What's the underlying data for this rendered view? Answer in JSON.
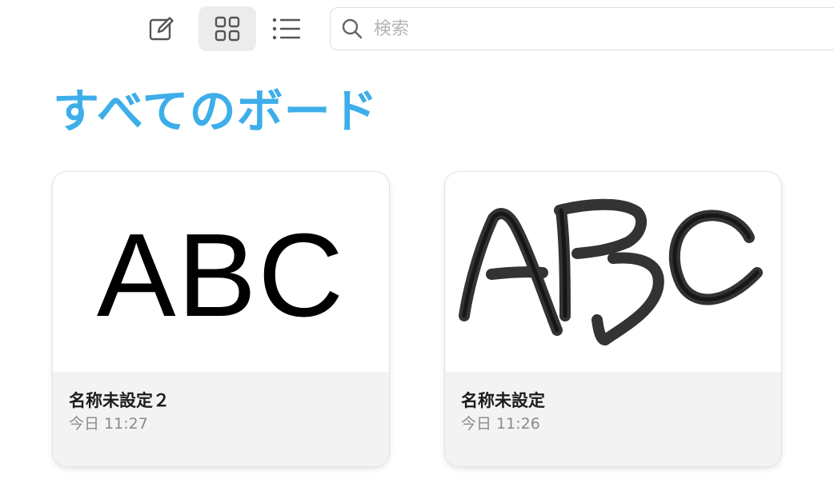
{
  "toolbar": {
    "compose_icon": "compose-icon",
    "grid_icon": "grid-view-icon",
    "list_icon": "list-view-icon",
    "active_view": "grid"
  },
  "search": {
    "icon": "search-icon",
    "placeholder": "検索",
    "value": ""
  },
  "page": {
    "title": "すべてのボード",
    "title_color": "#3daee9"
  },
  "boards": [
    {
      "name": "名称未設定２",
      "time": "今日 11:27",
      "thumbnail_text": "ABC"
    },
    {
      "name": "名称未設定",
      "time": "今日 11:26",
      "thumbnail_text": "ABC"
    }
  ]
}
